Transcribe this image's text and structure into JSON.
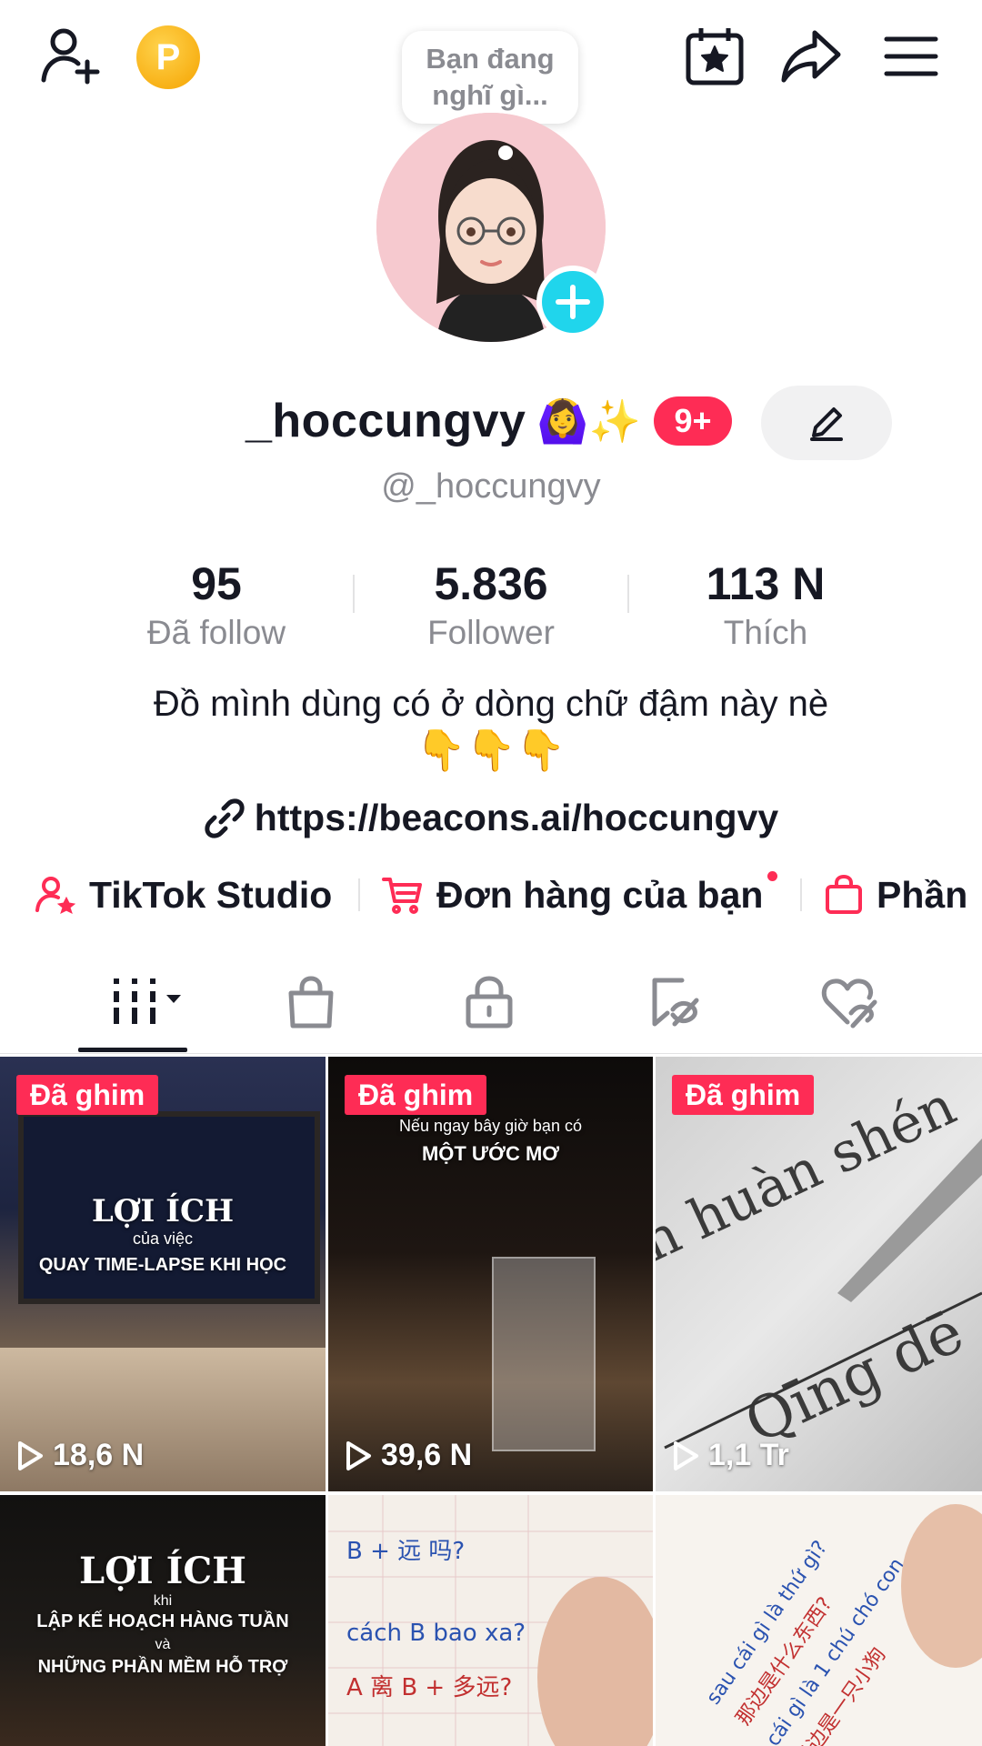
{
  "header": {
    "bubble_text": "Bạn đang nghĩ gì...",
    "coin_letter": "P",
    "icons": [
      "add-user-icon",
      "points-coin-icon",
      "calendar-star-icon",
      "share-icon",
      "menu-icon"
    ]
  },
  "profile": {
    "display_name": "_hoccungvy",
    "name_emoji": "🙆‍♀️✨",
    "notification_badge": "9+",
    "handle": "@_hoccungvy"
  },
  "stats": [
    {
      "value": "95",
      "label": "Đã follow"
    },
    {
      "value": "5.836",
      "label": "Follower"
    },
    {
      "value": "113 N",
      "label": "Thích"
    }
  ],
  "bio": {
    "text": "Đồ mình dùng có ở dòng chữ đậm này nè",
    "emoji": "👇👇👇",
    "link": "https://beacons.ai/hoccungvy"
  },
  "shortcuts": [
    {
      "label": "TikTok Studio",
      "icon": "studio-user-star-icon"
    },
    {
      "label": "Đơn hàng của bạn",
      "icon": "cart-icon"
    },
    {
      "label": "Phần",
      "icon": "shopping-bag-icon"
    }
  ],
  "tabs": [
    {
      "name": "videos",
      "icon": "grid-icon",
      "active": true
    },
    {
      "name": "shop",
      "icon": "shopping-bag-icon"
    },
    {
      "name": "private",
      "icon": "lock-icon"
    },
    {
      "name": "saved",
      "icon": "bookmark-hidden-icon"
    },
    {
      "name": "liked",
      "icon": "heart-hidden-icon"
    }
  ],
  "videos": [
    {
      "pinned": "Đã ghim",
      "views": "18,6 N",
      "overlay": [
        "LỢI ÍCH",
        "của việc",
        "QUAY TIME-LAPSE KHI HỌC"
      ]
    },
    {
      "pinned": "Đã ghim",
      "views": "39,6 N",
      "overlay": [
        "Nếu ngay bây giờ bạn có",
        "MỘT ƯỚC MƠ"
      ]
    },
    {
      "pinned": "Đã ghim",
      "views": "1,1 Tr",
      "overlay": []
    },
    {
      "pinned": "",
      "views": "",
      "overlay": [
        "LỢI ÍCH",
        "khi",
        "LẬP KẾ HOẠCH HÀNG TUẦN",
        "và",
        "NHỮNG PHẦN MỀM HỖ TRỢ"
      ]
    },
    {
      "pinned": "",
      "views": "",
      "overlay": []
    },
    {
      "pinned": "",
      "views": "",
      "overlay": []
    }
  ],
  "colors": {
    "accent": "#fe2c55",
    "plus": "#20d5ec",
    "text": "#161823",
    "muted": "#8a8b91"
  }
}
